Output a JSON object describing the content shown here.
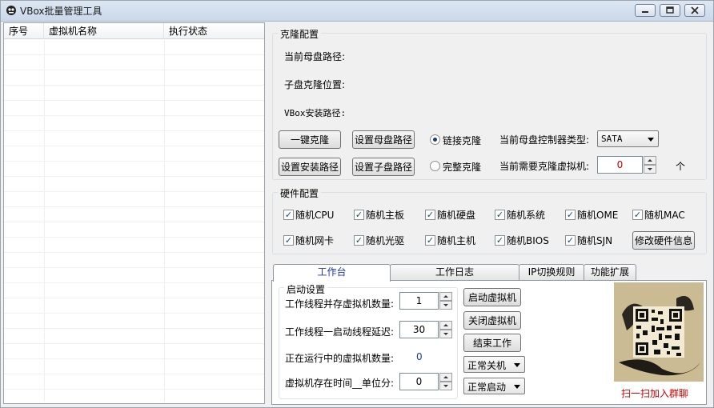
{
  "window": {
    "title": "VBox批量管理工具",
    "controls": {
      "minimize": "−",
      "maximize": "□",
      "close": "×"
    }
  },
  "list": {
    "columns": [
      "序号",
      "虚拟机名称",
      "执行状态"
    ],
    "rows": []
  },
  "clone": {
    "group_title": "克隆配置",
    "mother_disk_path_label": "当前母盘路径:",
    "child_clone_location_label": "子盘克隆位置:",
    "vbox_install_path_label": "VBox安装路径:",
    "one_click_clone_button": "一键克隆",
    "set_mother_path_button": "设置母盘路径",
    "set_install_path_button": "设置安装路径",
    "set_child_path_button": "设置子盘路径",
    "linked_clone_option": "链接克隆",
    "full_clone_option": "完整克隆",
    "controller_type_label": "当前母盘控制器类型:",
    "controller_type_value": "SATA",
    "clone_count_label": "当前需要克隆虚拟机:",
    "clone_count_value": "0",
    "clone_count_unit": "个"
  },
  "hardware": {
    "group_title": "硬件配置",
    "checkboxes": [
      {
        "label": "随机CPU",
        "checked": true
      },
      {
        "label": "随机主板",
        "checked": true
      },
      {
        "label": "随机硬盘",
        "checked": true
      },
      {
        "label": "随机系统",
        "checked": true
      },
      {
        "label": "随机OME",
        "checked": true
      },
      {
        "label": "随机MAC",
        "checked": true
      },
      {
        "label": "随机网卡",
        "checked": true
      },
      {
        "label": "随机光驱",
        "checked": true
      },
      {
        "label": "随机主机",
        "checked": true
      },
      {
        "label": "随机BIOS",
        "checked": true
      },
      {
        "label": "随机SJN",
        "checked": true
      }
    ],
    "modify_button": "修改硬件信息"
  },
  "tabs": [
    "工作台",
    "工作日志",
    "IP切换规则",
    "功能扩展"
  ],
  "workbench": {
    "group_title": "启动设置",
    "concurrent_label": "工作线程并存虚拟机数量:",
    "concurrent_value": "1",
    "delay_label": "工作线程一启动线程延迟:",
    "delay_value": "30",
    "running_label": "正在运行中的虚拟机数量:",
    "running_value": "0",
    "lifetime_label": "虚拟机存在时间__单位分:",
    "lifetime_value": "0",
    "start_vm_button": "启动虚拟机",
    "stop_vm_button": "关闭虚拟机",
    "end_work_button": "结束工作",
    "shutdown_mode": "正常关机",
    "startup_mode": "正常启动",
    "qr_caption": "扫一扫加入群聊"
  },
  "colors": {
    "accent_tab": "#1d37a8",
    "running_count": "#1d37a8",
    "qr_caption": "#d00000",
    "clone_count": "#c00000"
  }
}
